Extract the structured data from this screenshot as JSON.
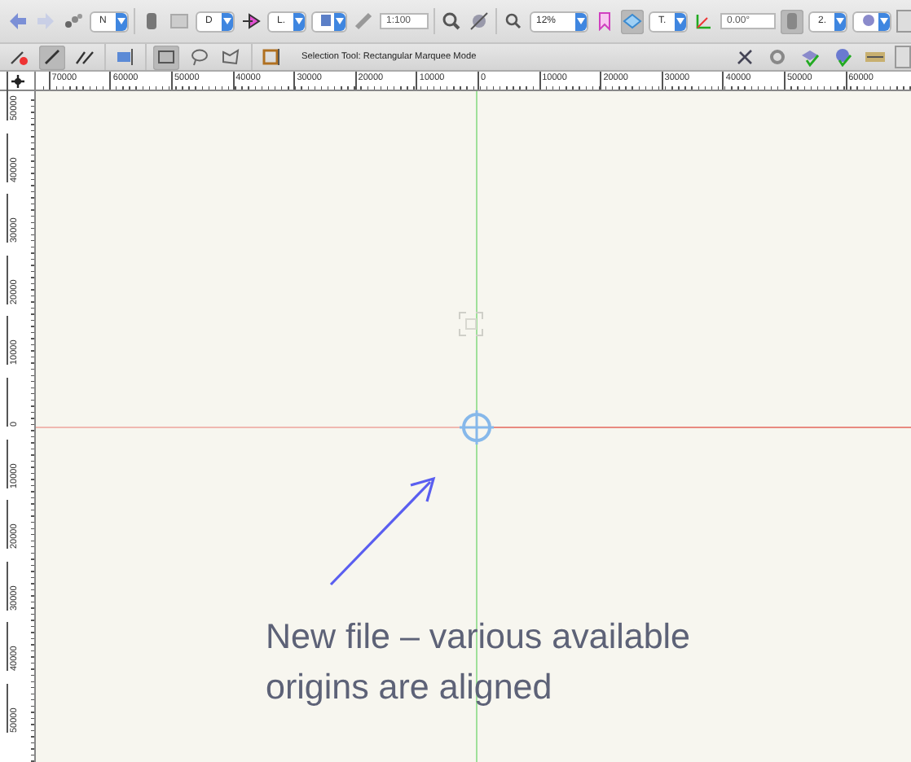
{
  "top_toolbar": {
    "class_menu": "N",
    "layer_menu": "D",
    "view_menu": "L.",
    "scale": "1:100",
    "zoom": "12%",
    "top_view_selected": true,
    "projection_menu": "T.",
    "rotation": "0.00°",
    "render_toggle_selected": true,
    "render_menu": "2."
  },
  "tool_bar": {
    "mode_buttons": [
      {
        "selected": false
      },
      {
        "selected": true
      },
      {
        "selected": false
      }
    ],
    "shape_buttons": [
      {
        "selected": true
      },
      {
        "selected": false
      },
      {
        "selected": false
      }
    ],
    "tool_hint": "Selection Tool: Rectangular Marquee Mode"
  },
  "top_ruler": {
    "labels": [
      "70000",
      "60000",
      "50000",
      "40000",
      "30000",
      "20000",
      "10000",
      "0",
      "10000",
      "20000",
      "30000",
      "40000",
      "50000",
      "60000"
    ]
  },
  "left_ruler": {
    "labels": [
      "50000",
      "40000",
      "30000",
      "20000",
      "10000",
      "0",
      "10000",
      "20000",
      "30000",
      "40000",
      "50000"
    ]
  },
  "canvas": {
    "annotation": "New file – various available origins are aligned"
  }
}
